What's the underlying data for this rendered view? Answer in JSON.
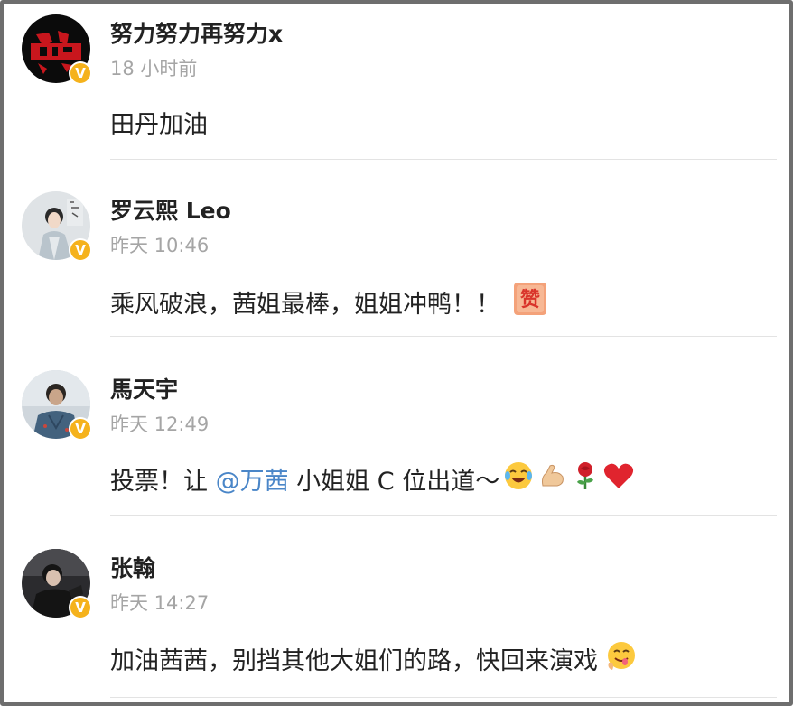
{
  "comments": [
    {
      "username": "努力努力再努力x",
      "time": "18 小时前",
      "text": "田丹加油",
      "badge": "V"
    },
    {
      "username": "罗云熙 Leo",
      "time": "昨天 10:46",
      "text": "乘风破浪，茜姐最棒，姐姐冲鸭！！",
      "emoji_label": "赞",
      "badge": "V"
    },
    {
      "username": "馬天宇",
      "time": "昨天 12:49",
      "text_prefix": "投票！让 ",
      "mention": "@万茜",
      "text_suffix": " 小姐姐 C 位出道～",
      "badge": "V",
      "emojis": [
        "laughing-crying-icon",
        "flexed-biceps-icon",
        "rose-icon",
        "red-heart-icon"
      ]
    },
    {
      "username": "张翰",
      "time": "昨天 14:27",
      "text": "加油茜茜，别挡其他大姐们的路，快回来演戏",
      "badge": "V",
      "emojis": [
        "yummy-face-icon"
      ]
    }
  ],
  "colors": {
    "badge": "#f5b21c",
    "mention": "#4a86c8",
    "time": "#a5a5a5",
    "divider": "#e3e3e3"
  }
}
